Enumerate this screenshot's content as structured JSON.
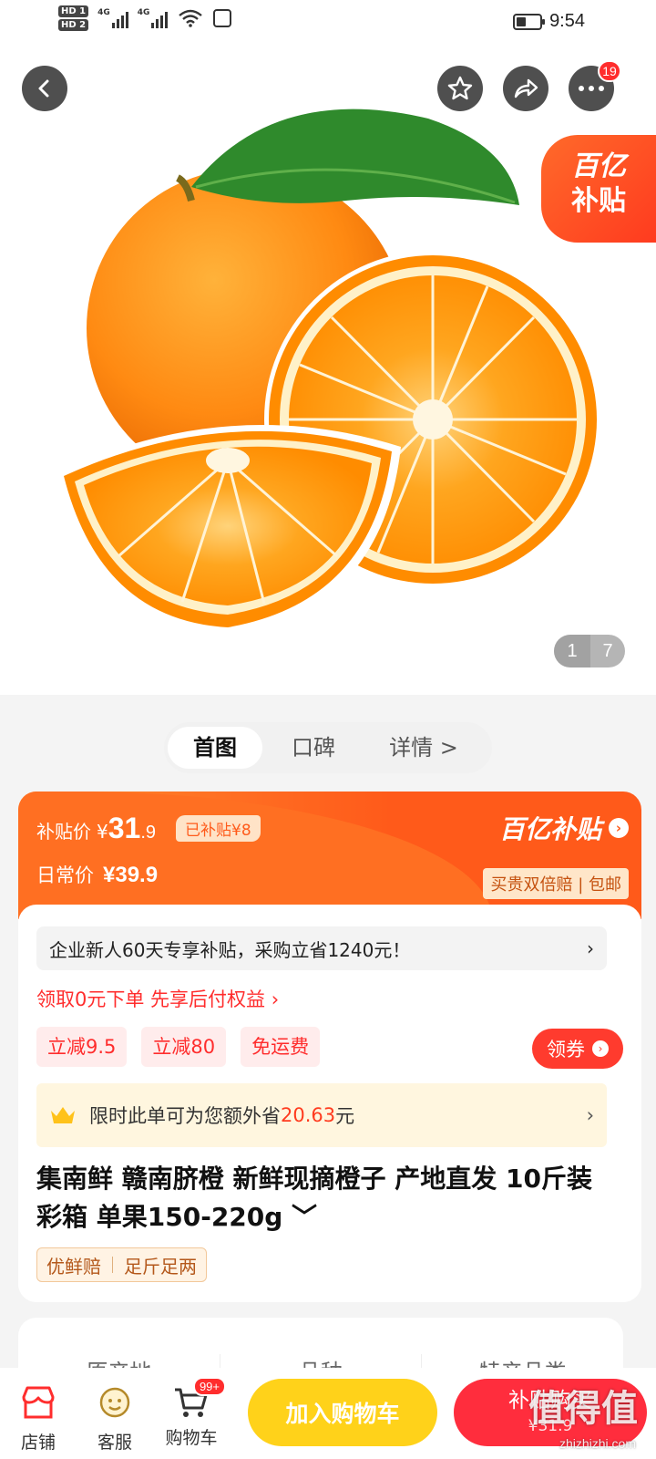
{
  "status_bar": {
    "sim1": "HD 1",
    "sim2": "HD 2",
    "net1": "4G",
    "net2": "4G",
    "time": "9:54"
  },
  "hero": {
    "more_badge": "19",
    "subsidy_tag_line1": "百亿",
    "subsidy_tag_line2": "补贴",
    "pager_current": "1",
    "pager_total": "7",
    "icons": [
      "back-icon",
      "star-icon",
      "share-icon",
      "more-icon"
    ]
  },
  "tabs": {
    "items": [
      {
        "label": "首图"
      },
      {
        "label": "口碑"
      },
      {
        "label": "详情 >"
      }
    ],
    "active_index": 0
  },
  "price": {
    "subsidy_label": "补贴价",
    "currency": "¥",
    "subsidy_int": "31",
    "subsidy_dec": ".9",
    "subsidized_chip": "已补贴¥8",
    "regular_label": "日常价",
    "regular_value": "¥39.9",
    "brand": "百亿补贴",
    "brand_arrow": "›",
    "promise": "买贵双倍赔 | 包邮"
  },
  "promo": {
    "enterprise": "企业新人60天专享补贴，采购立省1240元！",
    "enterprise_arrow": "›",
    "bnpl": "领取0元下单 先享后付权益 ›",
    "coupons": [
      {
        "label": "立减9.5"
      },
      {
        "label": "立减80"
      },
      {
        "label": "免运费"
      }
    ],
    "get_coupon": "领券",
    "get_coupon_arrow": "›",
    "vip_prefix": "限时此单可为您额外省",
    "vip_amount": "20.63",
    "vip_suffix": "元",
    "vip_arrow": "›"
  },
  "product": {
    "title": "集南鲜 赣南脐橙 新鲜现摘橙子 产地直发 10斤装彩箱 单果150-220g ﹀",
    "tags": [
      "优鲜赔",
      "足斤足两"
    ]
  },
  "attributes": {
    "items": [
      {
        "label": "原产地"
      },
      {
        "label": "品种"
      },
      {
        "label": "特产品类"
      }
    ]
  },
  "bottom_bar": {
    "store": "店铺",
    "service": "客服",
    "cart": "购物车",
    "cart_badge": "99+",
    "add_to_cart": "加入购物车",
    "buy_now": "补贴购买",
    "buy_now_price": "¥31.9"
  },
  "watermark": {
    "text": "值得值",
    "sub": "zhizhizhi.com"
  },
  "colors": {
    "accent_orange": "#ff5a1a",
    "accent_red": "#ff2d2d",
    "cart_yellow": "#ffd21a"
  }
}
